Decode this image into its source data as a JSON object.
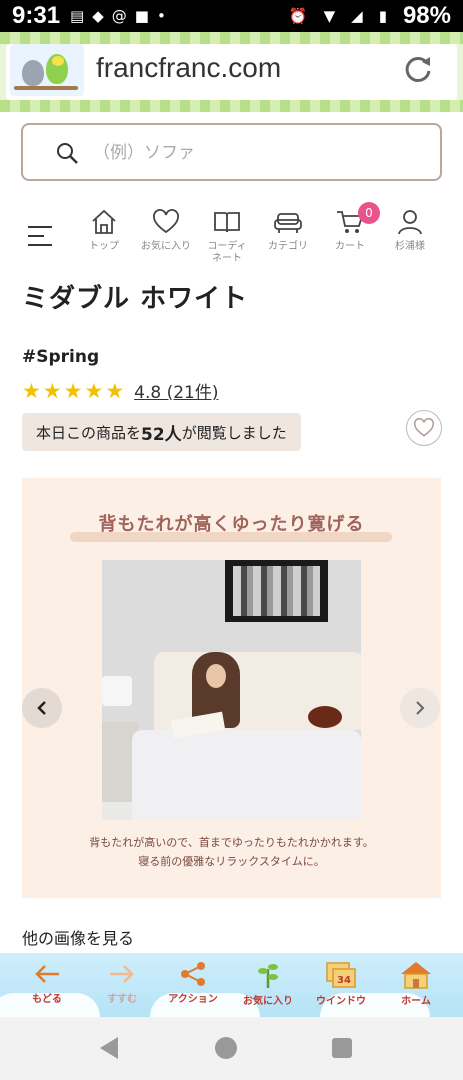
{
  "status_bar": {
    "time": "9:31",
    "battery": "98%",
    "icons": [
      "message-icon",
      "app-icon",
      "threads-icon",
      "square-icon",
      "alarm-icon",
      "wifi-icon",
      "signal-icon",
      "battery-icon"
    ]
  },
  "browser": {
    "url": "francfranc.com",
    "reload_icon": "reload-icon"
  },
  "search": {
    "placeholder": "（例）ソファ"
  },
  "nav": {
    "items": [
      {
        "label": "トップ",
        "icon": "home-icon"
      },
      {
        "label": "お気に入り",
        "icon": "heart-icon"
      },
      {
        "label": "コーディ\nネート",
        "icon": "book-icon"
      },
      {
        "label": "カテゴリ",
        "icon": "sofa-icon"
      },
      {
        "label": "カート",
        "icon": "cart-icon",
        "badge": "0"
      },
      {
        "label": "杉浦様",
        "icon": "user-icon"
      }
    ]
  },
  "product": {
    "title": "ミダブル ホワイト",
    "tag": "#Spring",
    "rating": "4.8 (21件)",
    "stars": 5,
    "views_pre": "本日この商品を",
    "views_count": "52人",
    "views_post": "が閲覧しました"
  },
  "gallery": {
    "headline": "背もたれが高くゆったり寛げる",
    "caption_line1": "背もたれが高いので、首までゆったりもたれかかれます。",
    "caption_line2": "寝る前の優雅なリラックスタイムに。",
    "more_label": "他の画像を見る"
  },
  "toolbar": {
    "items": [
      {
        "label": "もどる",
        "icon": "back-arrow-icon"
      },
      {
        "label": "すすむ",
        "icon": "forward-arrow-icon"
      },
      {
        "label": "アクション",
        "icon": "share-icon"
      },
      {
        "label": "お気に入り",
        "icon": "bookmark-plant-icon"
      },
      {
        "label": "ウインドウ",
        "icon": "window-icon",
        "count": "34"
      },
      {
        "label": "ホーム",
        "icon": "home-house-icon"
      }
    ]
  },
  "colors": {
    "accent": "#e8538c",
    "star": "#f2c200",
    "headline": "#a0645a",
    "toolbar_label": "#c0392b"
  }
}
